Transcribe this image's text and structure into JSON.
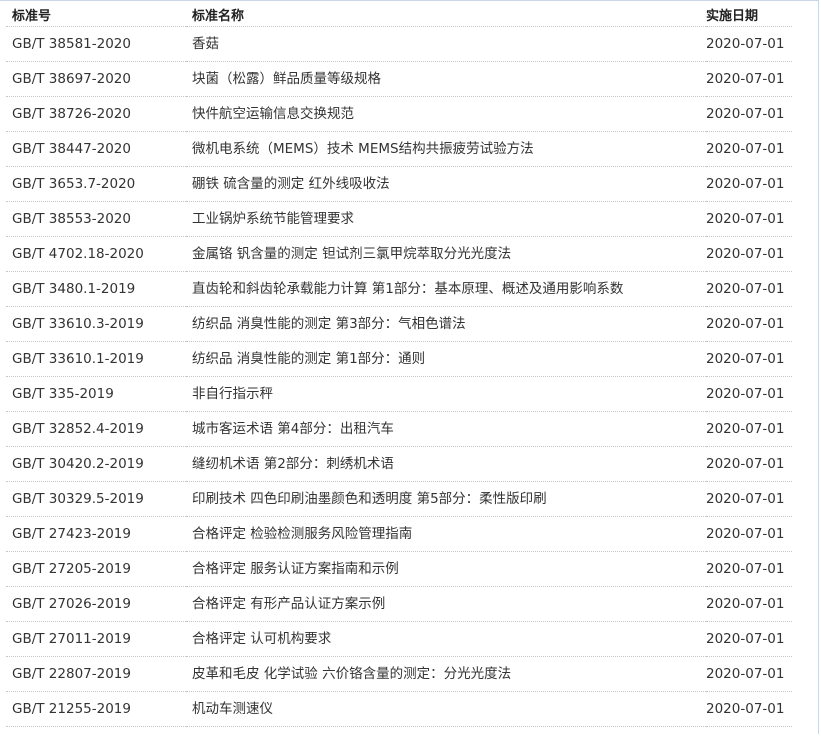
{
  "table": {
    "headers": {
      "code": "标准号",
      "name": "标准名称",
      "date": "实施日期"
    },
    "rows": [
      {
        "code": "GB/T 38581-2020",
        "name": "香菇",
        "date": "2020-07-01"
      },
      {
        "code": "GB/T 38697-2020",
        "name": "块菌（松露）鲜品质量等级规格",
        "date": "2020-07-01"
      },
      {
        "code": "GB/T 38726-2020",
        "name": "快件航空运输信息交换规范",
        "date": "2020-07-01"
      },
      {
        "code": "GB/T 38447-2020",
        "name": "微机电系统（MEMS）技术 MEMS结构共振疲劳试验方法",
        "date": "2020-07-01"
      },
      {
        "code": "GB/T 3653.7-2020",
        "name": "硼铁 硫含量的测定 红外线吸收法",
        "date": "2020-07-01"
      },
      {
        "code": "GB/T 38553-2020",
        "name": "工业锅炉系统节能管理要求",
        "date": "2020-07-01"
      },
      {
        "code": "GB/T 4702.18-2020",
        "name": "金属铬 钒含量的测定 钽试剂三氯甲烷萃取分光光度法",
        "date": "2020-07-01"
      },
      {
        "code": "GB/T 3480.1-2019",
        "name": "直齿轮和斜齿轮承载能力计算 第1部分：基本原理、概述及通用影响系数",
        "date": "2020-07-01"
      },
      {
        "code": "GB/T 33610.3-2019",
        "name": "纺织品 消臭性能的测定 第3部分：气相色谱法",
        "date": "2020-07-01"
      },
      {
        "code": "GB/T 33610.1-2019",
        "name": "纺织品 消臭性能的测定 第1部分：通则",
        "date": "2020-07-01"
      },
      {
        "code": "GB/T 335-2019",
        "name": "非自行指示秤",
        "date": "2020-07-01"
      },
      {
        "code": "GB/T 32852.4-2019",
        "name": "城市客运术语 第4部分：出租汽车",
        "date": "2020-07-01"
      },
      {
        "code": "GB/T 30420.2-2019",
        "name": "缝纫机术语 第2部分：刺绣机术语",
        "date": "2020-07-01"
      },
      {
        "code": "GB/T 30329.5-2019",
        "name": "印刷技术 四色印刷油墨颜色和透明度 第5部分：柔性版印刷",
        "date": "2020-07-01"
      },
      {
        "code": "GB/T 27423-2019",
        "name": "合格评定 检验检测服务风险管理指南",
        "date": "2020-07-01"
      },
      {
        "code": "GB/T 27205-2019",
        "name": "合格评定 服务认证方案指南和示例",
        "date": "2020-07-01"
      },
      {
        "code": "GB/T 27026-2019",
        "name": "合格评定 有形产品认证方案示例",
        "date": "2020-07-01"
      },
      {
        "code": "GB/T 27011-2019",
        "name": "合格评定 认可机构要求",
        "date": "2020-07-01"
      },
      {
        "code": "GB/T 22807-2019",
        "name": "皮革和毛皮 化学试验 六价铬含量的测定：分光光度法",
        "date": "2020-07-01"
      },
      {
        "code": "GB/T 21255-2019",
        "name": "机动车测速仪",
        "date": "2020-07-01"
      }
    ]
  },
  "colors": {
    "row_divider": "#b5cbe3",
    "frame_border": "#c9d6e6",
    "text": "#333333"
  }
}
